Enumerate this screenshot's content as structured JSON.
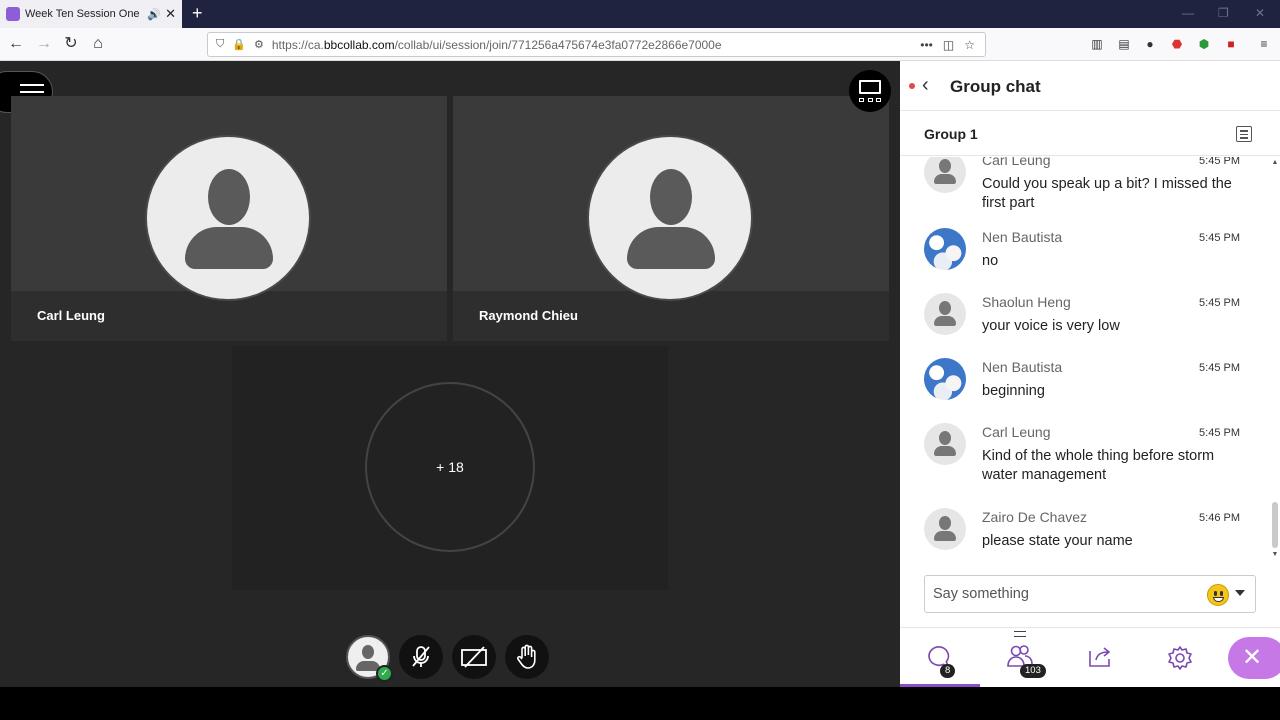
{
  "browser": {
    "tab_title": "Week Ten Session One : No",
    "url_prefix": "https://ca.",
    "url_host": "bbcollab.com",
    "url_path": "/collab/ui/session/join/771256a475674e3fa0772e2866e7000e",
    "tab_icon": "collab-icon"
  },
  "stage": {
    "participants": [
      {
        "name": "Carl Leung"
      },
      {
        "name": "Raymond Chieu"
      }
    ],
    "more_count": "+ 18"
  },
  "panel": {
    "title": "Group chat",
    "group": "Group 1",
    "messages": [
      {
        "author": "Carl Leung",
        "time": "5:45 PM",
        "text": "Could you speak up a bit? I missed the first part",
        "avatar": "default"
      },
      {
        "author": "Nen Bautista",
        "time": "5:45 PM",
        "text": "no",
        "avatar": "sky"
      },
      {
        "author": "Shaolun Heng",
        "time": "5:45 PM",
        "text": "your voice is very low",
        "avatar": "default"
      },
      {
        "author": "Nen Bautista",
        "time": "5:45 PM",
        "text": "beginning",
        "avatar": "sky"
      },
      {
        "author": "Carl Leung",
        "time": "5:45 PM",
        "text": "Kind of the whole thing before storm water management",
        "avatar": "default"
      },
      {
        "author": "Zairo De Chavez",
        "time": "5:46 PM",
        "text": "please state your name",
        "avatar": "default"
      }
    ],
    "compose_placeholder": "Say something",
    "chat_badge": "8",
    "attendees_badge": "103"
  },
  "colors": {
    "accent": "#8d4fc7",
    "close": "#c678e6",
    "status_ok": "#2faa4a"
  }
}
